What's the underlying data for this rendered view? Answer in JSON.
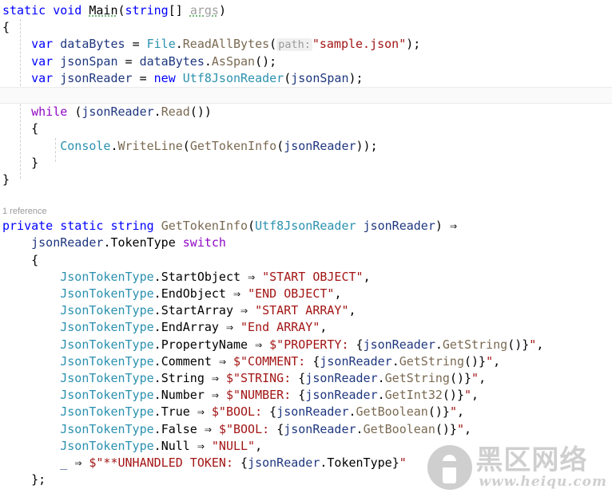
{
  "editor": {
    "language": "csharp",
    "background": "#ffffff",
    "colors": {
      "keyword": "#0000ff",
      "control_keyword": "#8f08c4",
      "type": "#2b91af",
      "string": "#a31515",
      "method": "#7a6a52",
      "local": "#1f377f",
      "plain": "#000000",
      "codelens": "#9a9a9a",
      "indent_guide": "#cfcfcf",
      "current_line": "#fafafa",
      "hint_background": "#f0f0f0",
      "squiggle": "#3fa34d"
    }
  },
  "codelens": {
    "label": "1 reference"
  },
  "hints": {
    "path_parameter": "path:"
  },
  "code": {
    "method_main": {
      "signature_keyword_static": "static",
      "signature_keyword_void": "void",
      "name": "Main",
      "param_type": "string[]",
      "param_name": "args"
    },
    "lines": [
      "static void Main(string[] args)",
      "{",
      "    var dataBytes = File.ReadAllBytes(path: \"sample.json\");",
      "    var jsonSpan = dataBytes.AsSpan();",
      "    var jsonReader = new Utf8JsonReader(jsonSpan);",
      "",
      "    while (jsonReader.Read())",
      "    {",
      "        Console.WriteLine(GetTokenInfo(jsonReader));",
      "    }",
      "}",
      "private static string GetTokenInfo(Utf8JsonReader jsonReader) =>",
      "    jsonReader.TokenType switch",
      "    {",
      "        JsonTokenType.StartObject => \"START OBJECT\",",
      "        JsonTokenType.EndObject => \"END OBJECT\",",
      "        JsonTokenType.StartArray => \"START ARRAY\",",
      "        JsonTokenType.EndArray => \"End ARRAY\",",
      "        JsonTokenType.PropertyName => $\"PROPERTY: {jsonReader.GetString()}\",",
      "        JsonTokenType.Comment => $\"COMMENT: {jsonReader.GetString()}\",",
      "        JsonTokenType.String => $\"STRING: {jsonReader.GetString()}\",",
      "        JsonTokenType.Number => $\"NUMBER: {jsonReader.GetInt32()}\",",
      "        JsonTokenType.True => $\"BOOL: {jsonReader.GetBoolean()}\",",
      "        JsonTokenType.False => $\"BOOL: {jsonReader.GetBoolean()}\",",
      "        JsonTokenType.Null => \"NULL\",",
      "        _ => $\"**UNHANDLED TOKEN: {jsonReader.TokenType}\"",
      "    };"
    ],
    "tokens": {
      "kw_static": "static",
      "kw_void": "void",
      "kw_string": "string",
      "kw_var": "var",
      "kw_new": "new",
      "kw_private": "private",
      "kw_while": "while",
      "kw_switch": "switch",
      "type_file": "File",
      "type_console": "Console",
      "type_utf8jsonreader": "Utf8JsonReader",
      "type_jsontokentype": "JsonTokenType",
      "method_readallbytes": "ReadAllBytes",
      "method_asspan": "AsSpan",
      "method_read": "Read",
      "method_writeline": "WriteLine",
      "method_gettokeninfo": "GetTokenInfo",
      "method_getstring": "GetString",
      "method_getint32": "GetInt32",
      "method_getboolean": "GetBoolean",
      "local_databytes": "dataBytes",
      "local_jsonspan": "jsonSpan",
      "local_jsonreader": "jsonReader",
      "local_args": "args",
      "prop_tokentype": "TokenType",
      "discard": "_",
      "arrow": "⇒",
      "lambda_arrow": "=>",
      "str_sample_json": "\"sample.json\"",
      "str_start_object": "\"START OBJECT\"",
      "str_end_object": "\"END OBJECT\"",
      "str_start_array": "\"START ARRAY\"",
      "str_end_array": "\"End ARRAY\"",
      "str_null": "\"NULL\""
    },
    "switch_cases": [
      {
        "case": "JsonTokenType.StartObject",
        "result": "\"START OBJECT\"",
        "interpolated": false
      },
      {
        "case": "JsonTokenType.EndObject",
        "result": "\"END OBJECT\"",
        "interpolated": false
      },
      {
        "case": "JsonTokenType.StartArray",
        "result": "\"START ARRAY\"",
        "interpolated": false
      },
      {
        "case": "JsonTokenType.EndArray",
        "result": "\"End ARRAY\"",
        "interpolated": false
      },
      {
        "case": "JsonTokenType.PropertyName",
        "result": "$\"PROPERTY: {jsonReader.GetString()}\"",
        "interpolated": true
      },
      {
        "case": "JsonTokenType.Comment",
        "result": "$\"COMMENT: {jsonReader.GetString()}\"",
        "interpolated": true
      },
      {
        "case": "JsonTokenType.String",
        "result": "$\"STRING: {jsonReader.GetString()}\"",
        "interpolated": true
      },
      {
        "case": "JsonTokenType.Number",
        "result": "$\"NUMBER: {jsonReader.GetInt32()}\"",
        "interpolated": true
      },
      {
        "case": "JsonTokenType.True",
        "result": "$\"BOOL: {jsonReader.GetBoolean()}\"",
        "interpolated": true
      },
      {
        "case": "JsonTokenType.False",
        "result": "$\"BOOL: {jsonReader.GetBoolean()}\"",
        "interpolated": true
      },
      {
        "case": "JsonTokenType.Null",
        "result": "\"NULL\"",
        "interpolated": false
      },
      {
        "case": "_",
        "result": "$\"**UNHANDLED TOKEN: {jsonReader.TokenType}\"",
        "interpolated": true
      }
    ]
  },
  "watermark": {
    "title": "黑区网络",
    "url": "www.heiqu.com"
  }
}
